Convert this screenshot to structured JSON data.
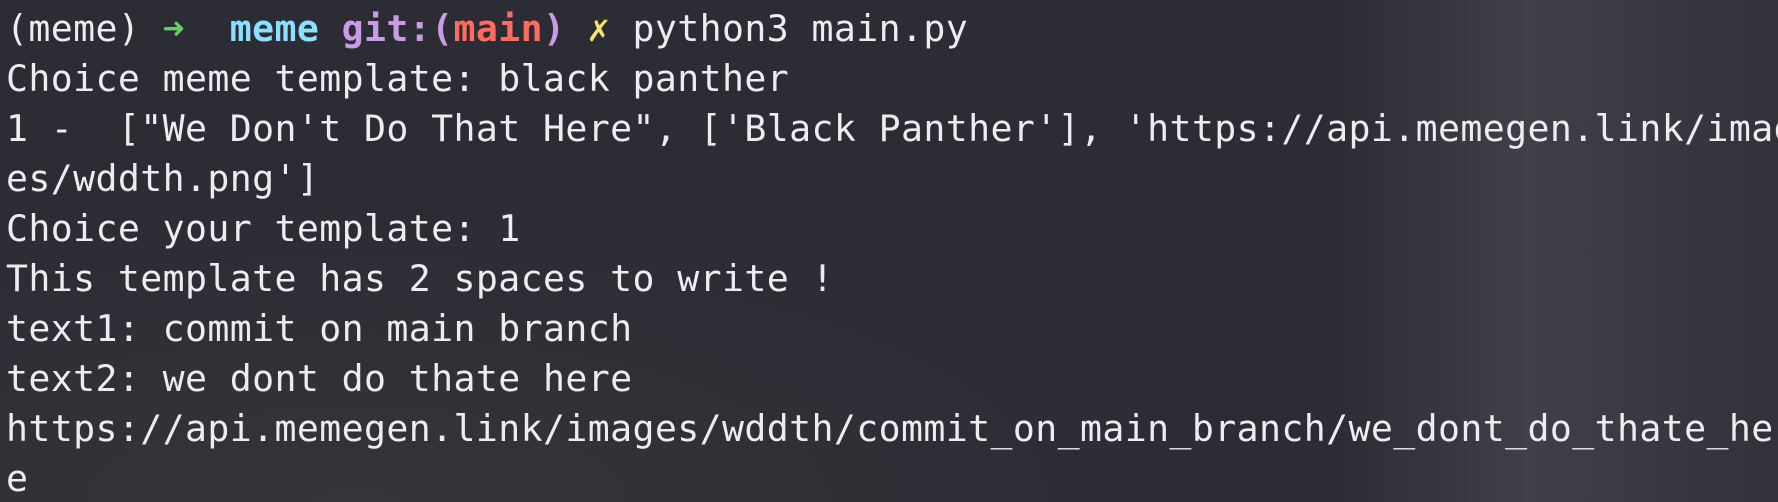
{
  "prompt": {
    "env": "(meme)",
    "arrow": "➜",
    "directory": "meme",
    "git_open": "git:(",
    "branch": "main",
    "git_close": ")",
    "dirty_marker": "✗",
    "command": "python3 main.py"
  },
  "output_lines": [
    "Choice meme template: black panther",
    "1 -  [\"We Don't Do That Here\", ['Black Panther'], 'https://api.memegen.link/imag",
    "es/wddth.png']",
    "Choice your template: 1",
    "This template has 2 spaces to write !",
    "text1: commit on main branch",
    "text2: we dont do thate here",
    "https://api.memegen.link/images/wddth/commit_on_main_branch/we_dont_do_thate_her",
    "e"
  ],
  "colors": {
    "background": "#2b2c34",
    "text": "#ecedee",
    "arrow": "#5fd35f",
    "directory": "#8be0ff",
    "git_label": "#c89be6",
    "branch": "#ff6b5e",
    "dirty_marker": "#f8e26a"
  }
}
